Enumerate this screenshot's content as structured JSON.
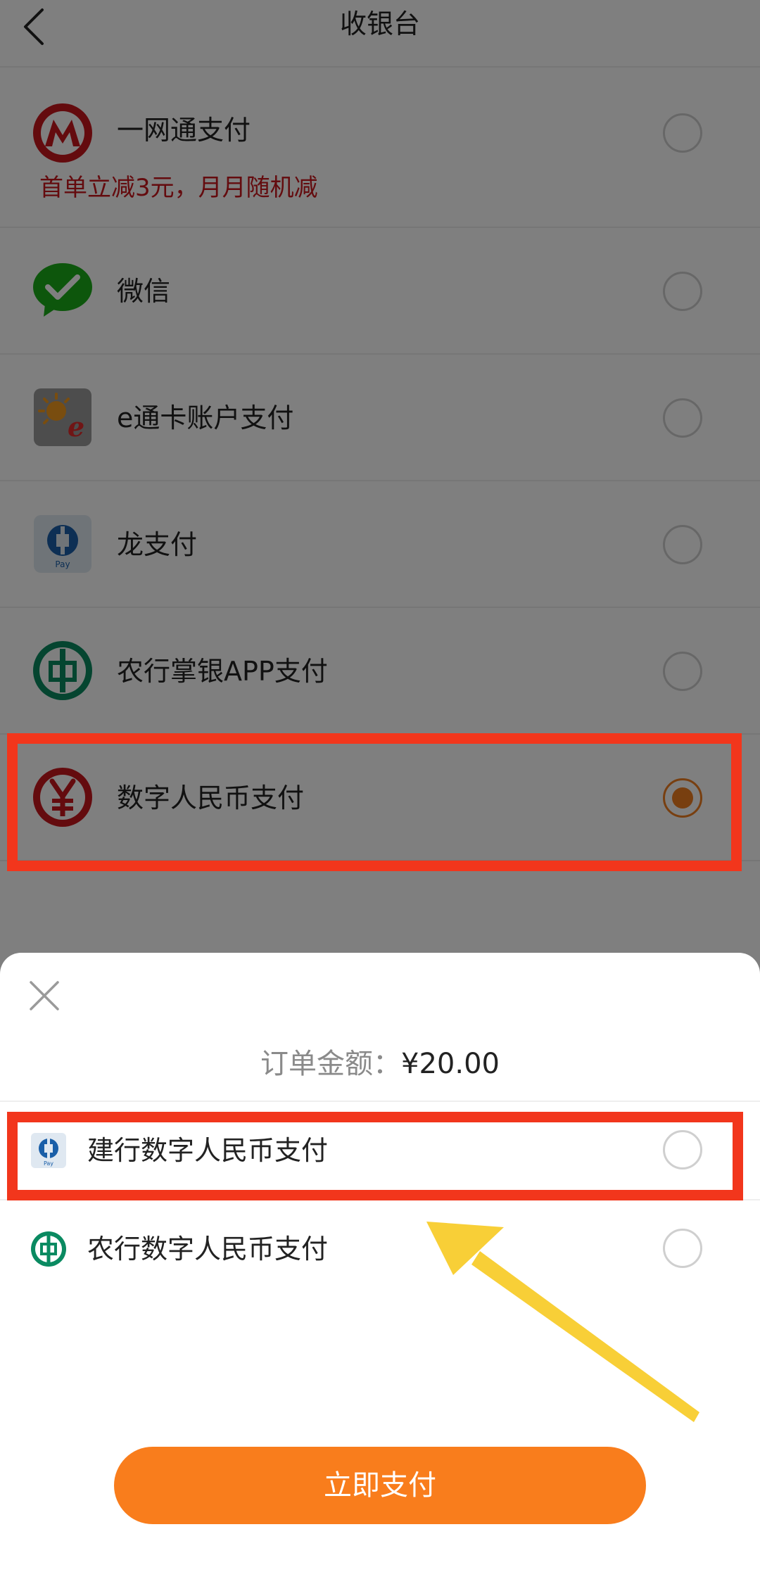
{
  "header": {
    "title": "收银台",
    "back_icon": "chevron-left-icon"
  },
  "payment_methods": [
    {
      "label": "一网通支付",
      "promo": "首单立减3元，月月随机减",
      "icon": "cmb-bank-logo-icon",
      "selected": false
    },
    {
      "label": "微信",
      "icon": "wechat-icon",
      "selected": false
    },
    {
      "label": "e通卡账户支付",
      "icon": "e-tong-card-icon",
      "selected": false
    },
    {
      "label": "龙支付",
      "icon": "long-pay-icon",
      "selected": false
    },
    {
      "label": "农行掌银APP支付",
      "icon": "abc-bank-logo-icon",
      "selected": false
    },
    {
      "label": "数字人民币支付",
      "icon": "digital-rmb-icon",
      "selected": true
    }
  ],
  "sheet": {
    "close_icon": "close-icon",
    "amount_label": "订单金额：",
    "amount_value": "¥20.00",
    "options": [
      {
        "label": "建行数字人民币支付",
        "icon": "ccb-pay-icon",
        "selected": false
      },
      {
        "label": "农行数字人民币支付",
        "icon": "abc-bank-logo-icon",
        "selected": false
      }
    ],
    "pay_button_label": "立即支付"
  },
  "colors": {
    "accent": "#f97d1c",
    "radio_selected": "#f07e21",
    "promo_text": "#c8161d",
    "highlight_box": "#f2361c",
    "arrow": "#f8cf37"
  }
}
